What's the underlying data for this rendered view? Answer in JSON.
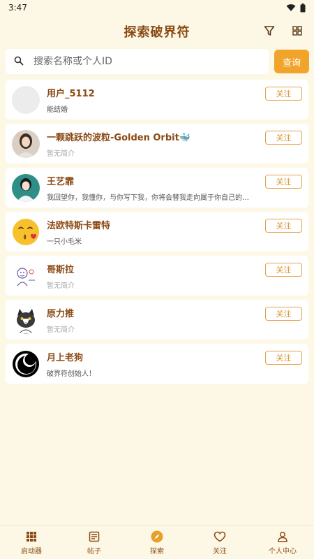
{
  "status_bar": {
    "time": "3:47"
  },
  "header": {
    "title": "探索破界符",
    "icons": [
      "filter-icon",
      "grid-icon"
    ]
  },
  "search": {
    "placeholder": "搜索名称或个人ID",
    "value": "",
    "button_label": "查询"
  },
  "users": [
    {
      "name": "用户_5112",
      "bio": "能结婚",
      "follow_label": "关注",
      "avatar": "blank"
    },
    {
      "name": "一颗跳跃的波粒-Golden Orbit🐳",
      "bio": "暂无简介",
      "follow_label": "关注",
      "avatar": "photo-girl"
    },
    {
      "name": "王艺霏",
      "bio": "我回望你，我懂你，与你写下我，你将会替我走向属于你自己的生活，你与我…",
      "follow_label": "关注",
      "avatar": "photo-teal"
    },
    {
      "name": "法欧特斯卡雷特",
      "bio": "一只小毛米",
      "follow_label": "关注",
      "avatar": "kiss-emoji"
    },
    {
      "name": "哥斯拉",
      "bio": "暂无简介",
      "follow_label": "关注",
      "avatar": "sketch"
    },
    {
      "name": "原力推",
      "bio": "暂无简介",
      "follow_label": "关注",
      "avatar": "cat"
    },
    {
      "name": "月上老狗",
      "bio": "破界符创始人！",
      "follow_label": "关注",
      "avatar": "moon-logo"
    }
  ],
  "bottom_nav": [
    {
      "label": "启动器",
      "icon": "apps-icon"
    },
    {
      "label": "帖子",
      "icon": "post-icon"
    },
    {
      "label": "探索",
      "icon": "compass-icon"
    },
    {
      "label": "关注",
      "icon": "heart-icon"
    },
    {
      "label": "个人中心",
      "icon": "person-icon"
    }
  ],
  "colors": {
    "accent": "#f0a52a",
    "title": "#8b4a14",
    "background": "#fdf8e6"
  }
}
